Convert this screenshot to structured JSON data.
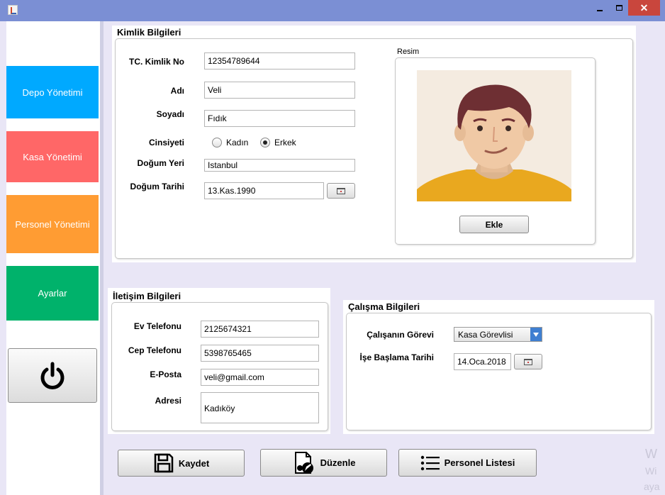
{
  "window": {
    "close_symbol": "✕"
  },
  "sidebar": {
    "items": [
      {
        "label": "Depo Yönetimi",
        "color": "#00a9ff"
      },
      {
        "label": "Kasa Yönetimi",
        "color": "#ff6767"
      },
      {
        "label": "Personel Yönetimi",
        "color": "#ff9c33"
      },
      {
        "label": "Ayarlar",
        "color": "#00b26b"
      }
    ],
    "power_icon": "power-icon"
  },
  "kimlik": {
    "title": "Kimlik Bilgileri",
    "tc_label": "TC. Kimlik No",
    "tc_value": "12354789644",
    "ad_label": "Adı",
    "ad_value": "Veli",
    "soyad_label": "Soyadı",
    "soyad_value": "Fıdık",
    "cinsiyet_label": "Cinsiyeti",
    "cinsiyet_options": [
      "Kadın",
      "Erkek"
    ],
    "cinsiyet_selected": "Erkek",
    "dogum_yeri_label": "Doğum Yeri",
    "dogum_yeri_value": "Istanbul",
    "dogum_tarihi_label": "Doğum Tarihi",
    "dogum_tarihi_value": "13.Kas.1990",
    "resim_label": "Resim",
    "ekle_label": "Ekle"
  },
  "iletisim": {
    "title": "İletişim Bilgileri",
    "ev_label": "Ev Telefonu",
    "ev_value": "2125674321",
    "cep_label": "Cep Telefonu",
    "cep_value": "5398765465",
    "eposta_label": "E-Posta",
    "eposta_value": "veli@gmail.com",
    "adres_label": "Adresi",
    "adres_value": "Kadıköy"
  },
  "calisma": {
    "title": "Çalışma Bilgileri",
    "gorev_label": "Çalışanın Görevi",
    "gorev_value": "Kasa Görevlisi",
    "baslama_label": "İşe Başlama Tarihi",
    "baslama_value": "14.Oca.2018"
  },
  "actions": {
    "kaydet": "Kaydet",
    "duzenle": "Düzenle",
    "liste": "Personel Listesi"
  },
  "watermark": {
    "line1": "W",
    "line2": "Wi",
    "line3": "aya"
  }
}
